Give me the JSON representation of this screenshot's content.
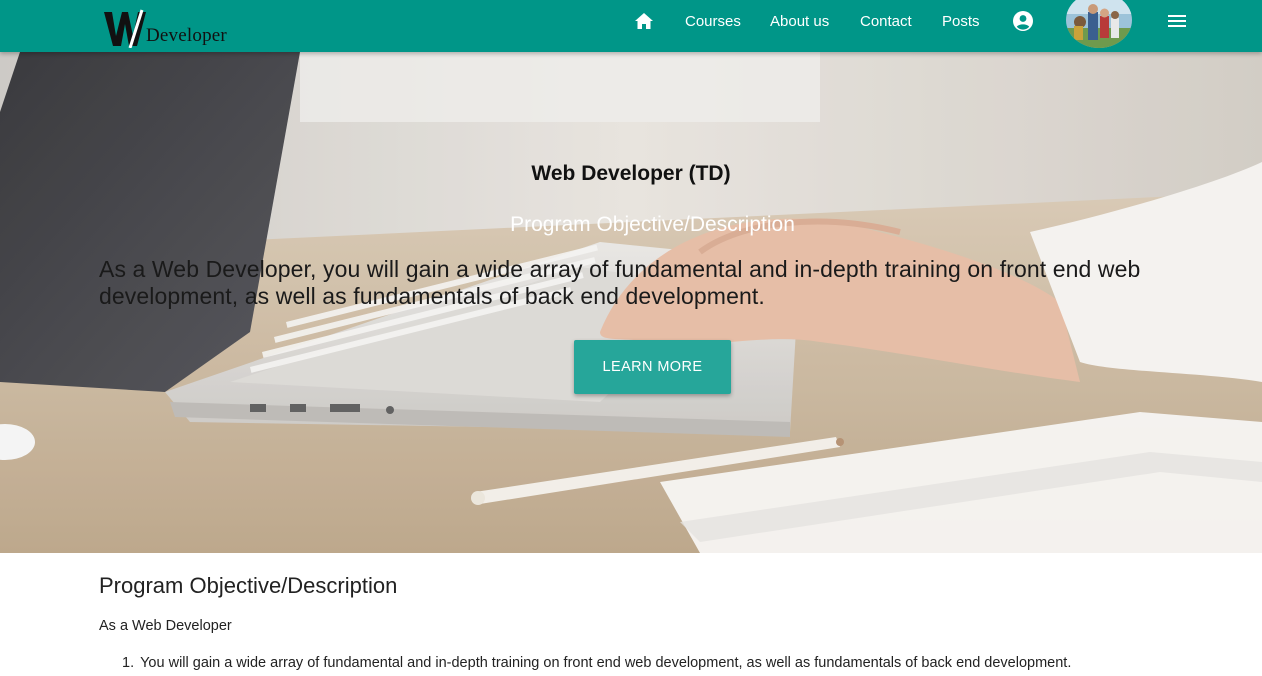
{
  "brand": {
    "logo_text": "W",
    "name": "Developer"
  },
  "nav": {
    "home_icon": "home-icon",
    "items": [
      {
        "label": "Courses"
      },
      {
        "label": "About us"
      },
      {
        "label": "Contact"
      },
      {
        "label": "Posts"
      }
    ],
    "account_icon": "account-circle-icon",
    "menu_icon": "hamburger-menu-icon"
  },
  "hero": {
    "title": "Web Developer (TD)",
    "subtitle": "Program Objective/Description",
    "description": "As a Web Developer, you will gain a wide array of fundamental and in-depth training on front end web development, as well as fundamentals of back end development.",
    "button_label": "LEARN MORE"
  },
  "content": {
    "title": "Program Objective/Description",
    "intro": "As a Web Developer",
    "list": [
      {
        "number": "1.",
        "text": "You will gain a wide array of fundamental and in-depth training on front end web development, as well as fundamentals of back end development."
      }
    ]
  },
  "colors": {
    "navbar": "#009688",
    "button": "#26a69a"
  }
}
